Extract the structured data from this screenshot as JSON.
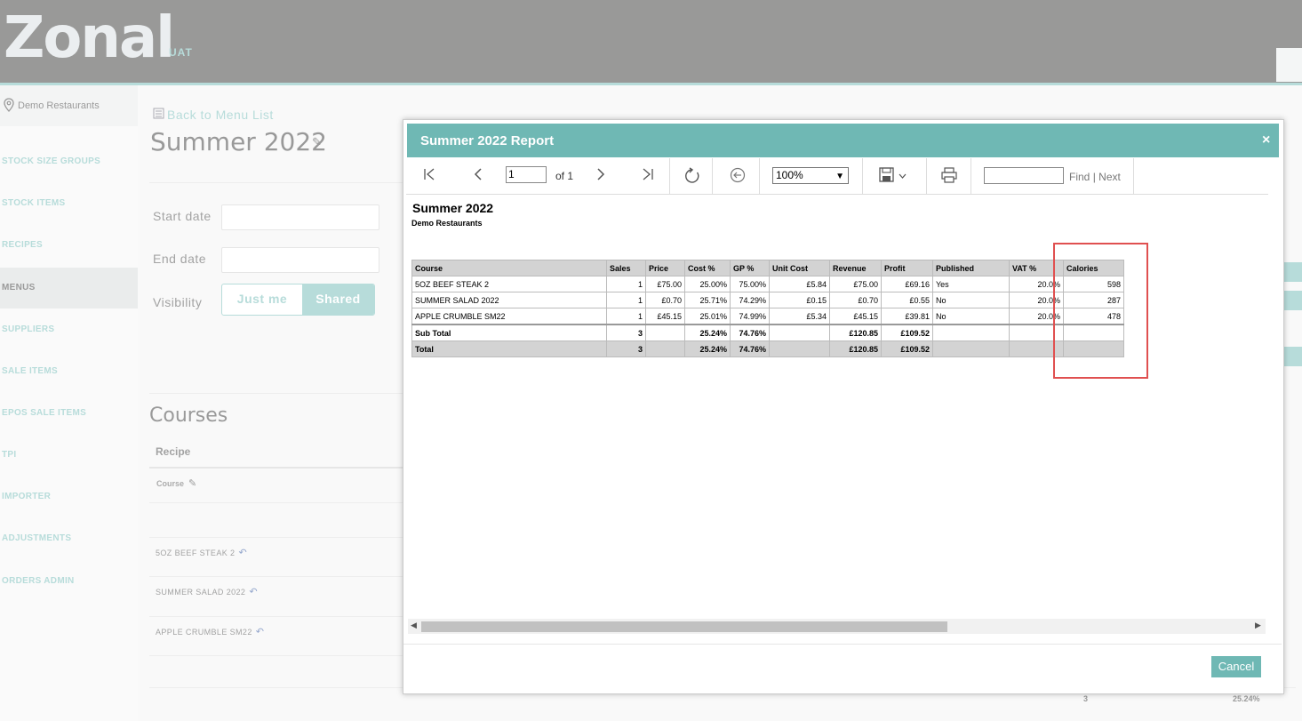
{
  "header": {
    "logo": "Zonal",
    "logo_env": "UAT"
  },
  "sidebar": {
    "location": "Demo Restaurants",
    "items": [
      {
        "label": "STOCK SIZE GROUPS"
      },
      {
        "label": "STOCK ITEMS"
      },
      {
        "label": "RECIPES"
      },
      {
        "label": "MENUS"
      },
      {
        "label": "SUPPLIERS"
      },
      {
        "label": "SALE ITEMS"
      },
      {
        "label": "EPOS SALE ITEMS"
      },
      {
        "label": "TPI"
      },
      {
        "label": "IMPORTER"
      },
      {
        "label": "ADJUSTMENTS"
      },
      {
        "label": "ORDERS ADMIN"
      }
    ]
  },
  "menu_page": {
    "back_link": "Back to Menu List",
    "title": "Summer 2022",
    "start_date_label": "Start date",
    "end_date_label": "End date",
    "visibility_label": "Visibility",
    "visibility_options": [
      "Just me",
      "Shared"
    ],
    "courses_heading": "Courses",
    "recipe_col": "Recipe",
    "course_label": "Course",
    "recipes": [
      "5OZ BEEF STEAK 2",
      "SUMMER SALAD 2022",
      "APPLE CRUMBLE SM22"
    ],
    "footer_sales": "3",
    "footer_cost_pct": "25.24%"
  },
  "modal": {
    "title": "Summer 2022 Report",
    "close": "×",
    "toolbar": {
      "page_value": "1",
      "of_pages": "of 1",
      "zoom": "100%",
      "find_label": "Find",
      "separator": "|",
      "next_label": "Next"
    },
    "report": {
      "title": "Summer 2022",
      "subtitle": "Demo Restaurants",
      "columns": [
        "Course",
        "Sales",
        "Price",
        "Cost %",
        "GP %",
        "Unit Cost",
        "Revenue",
        "Profit",
        "Published",
        "VAT %",
        "Calories"
      ],
      "rows": [
        {
          "course": "5OZ BEEF STEAK 2",
          "sales": "1",
          "price": "£75.00",
          "cost": "25.00%",
          "gp": "75.00%",
          "unit_cost": "£5.84",
          "revenue": "£75.00",
          "profit": "£69.16",
          "published": "Yes",
          "vat": "20.0%",
          "calories": "598"
        },
        {
          "course": "SUMMER SALAD 2022",
          "sales": "1",
          "price": "£0.70",
          "cost": "25.71%",
          "gp": "74.29%",
          "unit_cost": "£0.15",
          "revenue": "£0.70",
          "profit": "£0.55",
          "published": "No",
          "vat": "20.0%",
          "calories": "287"
        },
        {
          "course": "APPLE CRUMBLE SM22",
          "sales": "1",
          "price": "£45.15",
          "cost": "25.01%",
          "gp": "74.99%",
          "unit_cost": "£5.34",
          "revenue": "£45.15",
          "profit": "£39.81",
          "published": "No",
          "vat": "20.0%",
          "calories": "478"
        }
      ],
      "subtotal": {
        "label": "Sub Total",
        "sales": "3",
        "cost": "25.24%",
        "gp": "74.76%",
        "revenue": "£120.85",
        "profit": "£109.52"
      },
      "total": {
        "label": "Total",
        "sales": "3",
        "cost": "25.24%",
        "gp": "74.76%",
        "revenue": "£120.85",
        "profit": "£109.52"
      }
    },
    "cancel_label": "Cancel"
  },
  "colors": {
    "accent": "#6fb8b4",
    "header_bg": "#333331",
    "highlight": "#e05050"
  }
}
